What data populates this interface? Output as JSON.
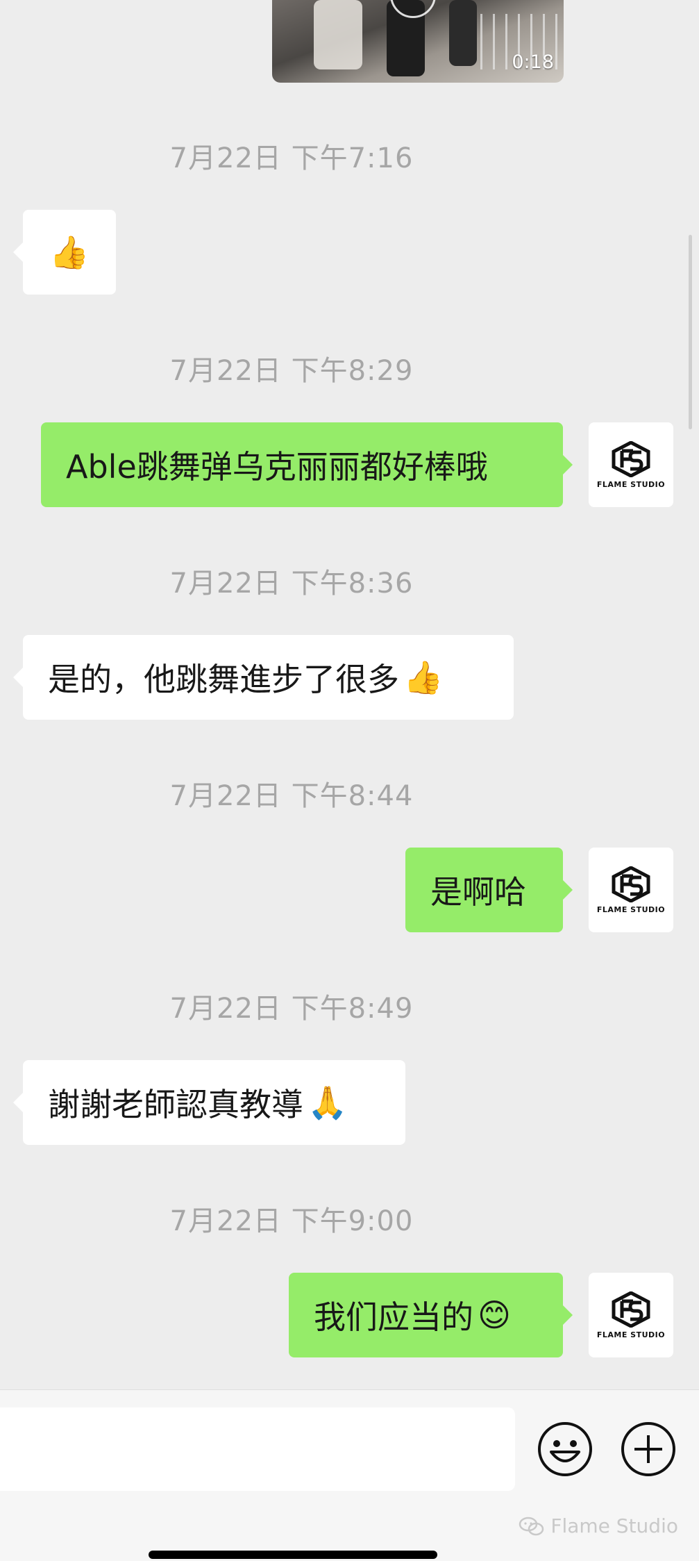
{
  "video": {
    "duration": "0:18"
  },
  "messages": [
    {
      "timestamp": "7月22日 下午7:16",
      "side": "left",
      "text": "",
      "emoji": "👍"
    },
    {
      "timestamp": "7月22日 下午8:29",
      "side": "right",
      "text": "Able跳舞弹乌克丽丽都好棒哦",
      "emoji": ""
    },
    {
      "timestamp": "7月22日 下午8:36",
      "side": "left",
      "text": "是的，他跳舞進步了很多",
      "emoji": "👍"
    },
    {
      "timestamp": "7月22日 下午8:44",
      "side": "right",
      "text": "是啊哈",
      "emoji": ""
    },
    {
      "timestamp": "7月22日 下午8:49",
      "side": "left",
      "text": "謝謝老師認真教導",
      "emoji": "🙏"
    },
    {
      "timestamp": "7月22日 下午9:00",
      "side": "right",
      "text": "我们应当的",
      "emoji": "😊"
    }
  ],
  "avatar": {
    "label": "FLAME STUDIO",
    "icon": "flame-studio-logo"
  },
  "input_bar": {
    "value": "",
    "emoji_icon": "smiley-face-icon",
    "plus_icon": "plus-circle-icon"
  },
  "watermark": {
    "text": "Flame Studio",
    "icon": "wechat-icon"
  },
  "colors": {
    "background": "#ededed",
    "sent_bubble": "#95ec69",
    "received_bubble": "#ffffff",
    "timestamp": "#a6a6a6"
  }
}
